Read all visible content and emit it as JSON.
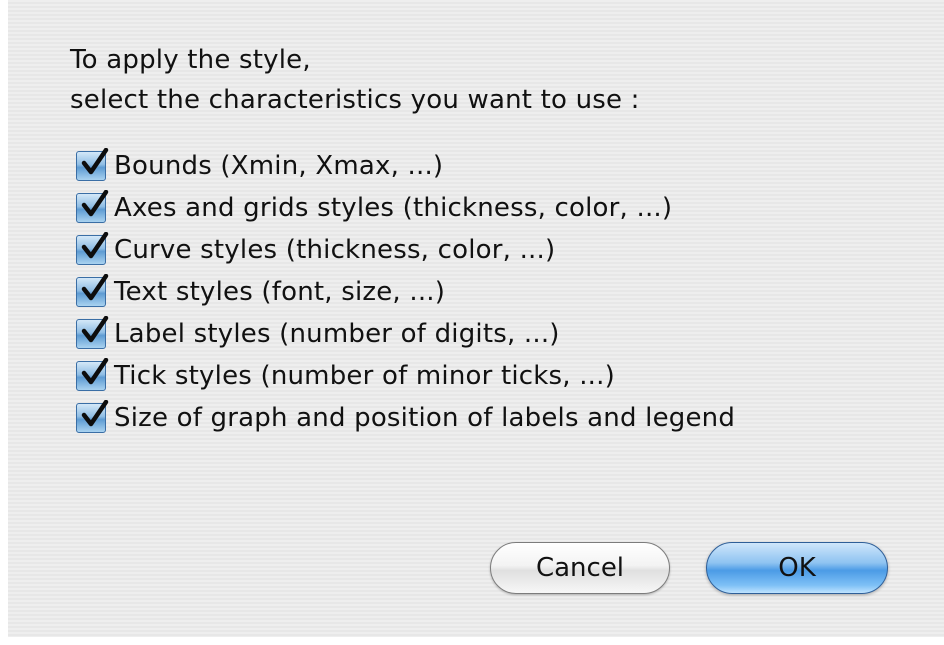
{
  "dialog": {
    "intro_line1": "To apply the style,",
    "intro_line2": "select the characteristics you want to use :"
  },
  "options": [
    {
      "label": "Bounds (Xmin, Xmax, ...)",
      "checked": true
    },
    {
      "label": "Axes and grids styles (thickness, color, ...)",
      "checked": true
    },
    {
      "label": "Curve styles (thickness, color, ...)",
      "checked": true
    },
    {
      "label": "Text styles (font, size, ...)",
      "checked": true
    },
    {
      "label": "Label styles (number of digits, ...)",
      "checked": true
    },
    {
      "label": "Tick styles (number of minor ticks, ...)",
      "checked": true
    },
    {
      "label": "Size of graph and position of labels and legend",
      "checked": true
    }
  ],
  "buttons": {
    "cancel_label": "Cancel",
    "ok_label": "OK"
  },
  "colors": {
    "dialog_background": "#ececec",
    "checkbox_accent": "#5e9bd2",
    "default_button": "#4b9be6"
  },
  "icons": {
    "checkbox_mark": "check-icon"
  }
}
